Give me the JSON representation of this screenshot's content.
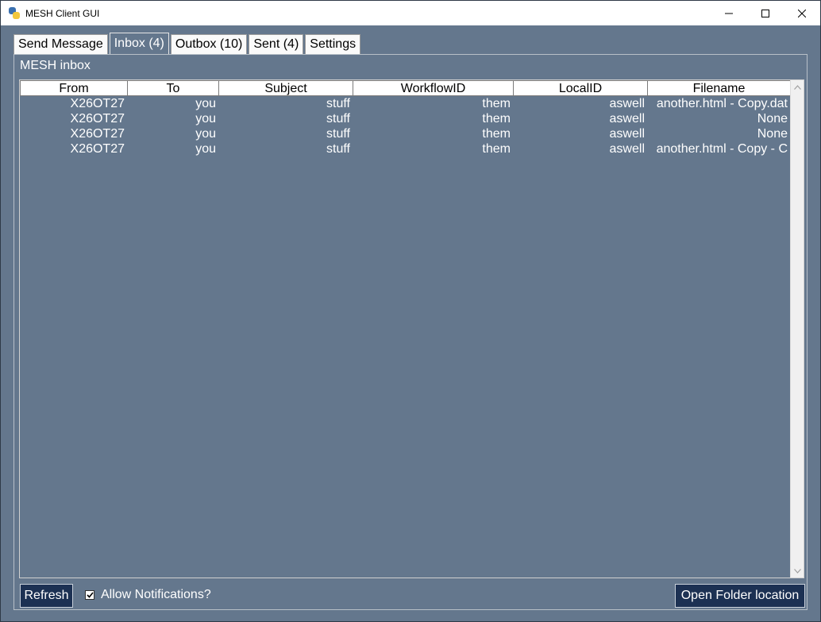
{
  "window": {
    "title": "MESH Client GUI",
    "controls": {
      "minimize_icon": "minimize-icon",
      "maximize_icon": "maximize-icon",
      "close_icon": "close-icon"
    }
  },
  "tabs": [
    {
      "label": "Send Message",
      "active": false
    },
    {
      "label": "Inbox (4)",
      "active": true
    },
    {
      "label": "Outbox (10)",
      "active": false
    },
    {
      "label": "Sent (4)",
      "active": false
    },
    {
      "label": "Settings",
      "active": false
    }
  ],
  "inbox": {
    "title": "MESH inbox",
    "columns": [
      "From",
      "To",
      "Subject",
      "WorkflowID",
      "LocalID",
      "Filename"
    ],
    "rows": [
      [
        "X26OT27",
        "you",
        "stuff",
        "them",
        "aswell",
        "another.html - Copy.dat"
      ],
      [
        "X26OT27",
        "you",
        "stuff",
        "them",
        "aswell",
        "None"
      ],
      [
        "X26OT27",
        "you",
        "stuff",
        "them",
        "aswell",
        "None"
      ],
      [
        "X26OT27",
        "you",
        "stuff",
        "them",
        "aswell",
        "another.html - Copy - C"
      ]
    ]
  },
  "controls": {
    "refresh_label": "Refresh",
    "allow_notifications_label": "Allow Notifications?",
    "allow_notifications_checked": true,
    "open_folder_label": "Open Folder location"
  },
  "colors": {
    "background": "#64778d",
    "button": "#1c3153",
    "text": "#ffffff"
  }
}
